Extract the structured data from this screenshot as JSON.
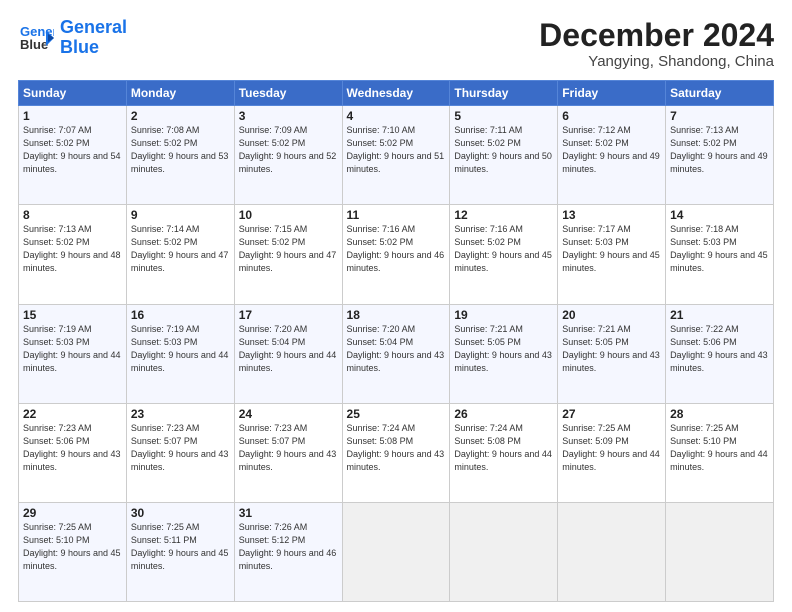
{
  "header": {
    "logo_line1": "General",
    "logo_line2": "Blue",
    "main_title": "December 2024",
    "subtitle": "Yangying, Shandong, China"
  },
  "days_of_week": [
    "Sunday",
    "Monday",
    "Tuesday",
    "Wednesday",
    "Thursday",
    "Friday",
    "Saturday"
  ],
  "weeks": [
    [
      {
        "num": "1",
        "sunrise": "7:07 AM",
        "sunset": "5:02 PM",
        "daylight": "9 hours and 54 minutes."
      },
      {
        "num": "2",
        "sunrise": "7:08 AM",
        "sunset": "5:02 PM",
        "daylight": "9 hours and 53 minutes."
      },
      {
        "num": "3",
        "sunrise": "7:09 AM",
        "sunset": "5:02 PM",
        "daylight": "9 hours and 52 minutes."
      },
      {
        "num": "4",
        "sunrise": "7:10 AM",
        "sunset": "5:02 PM",
        "daylight": "9 hours and 51 minutes."
      },
      {
        "num": "5",
        "sunrise": "7:11 AM",
        "sunset": "5:02 PM",
        "daylight": "9 hours and 50 minutes."
      },
      {
        "num": "6",
        "sunrise": "7:12 AM",
        "sunset": "5:02 PM",
        "daylight": "9 hours and 49 minutes."
      },
      {
        "num": "7",
        "sunrise": "7:13 AM",
        "sunset": "5:02 PM",
        "daylight": "9 hours and 49 minutes."
      }
    ],
    [
      {
        "num": "8",
        "sunrise": "7:13 AM",
        "sunset": "5:02 PM",
        "daylight": "9 hours and 48 minutes."
      },
      {
        "num": "9",
        "sunrise": "7:14 AM",
        "sunset": "5:02 PM",
        "daylight": "9 hours and 47 minutes."
      },
      {
        "num": "10",
        "sunrise": "7:15 AM",
        "sunset": "5:02 PM",
        "daylight": "9 hours and 47 minutes."
      },
      {
        "num": "11",
        "sunrise": "7:16 AM",
        "sunset": "5:02 PM",
        "daylight": "9 hours and 46 minutes."
      },
      {
        "num": "12",
        "sunrise": "7:16 AM",
        "sunset": "5:02 PM",
        "daylight": "9 hours and 45 minutes."
      },
      {
        "num": "13",
        "sunrise": "7:17 AM",
        "sunset": "5:03 PM",
        "daylight": "9 hours and 45 minutes."
      },
      {
        "num": "14",
        "sunrise": "7:18 AM",
        "sunset": "5:03 PM",
        "daylight": "9 hours and 45 minutes."
      }
    ],
    [
      {
        "num": "15",
        "sunrise": "7:19 AM",
        "sunset": "5:03 PM",
        "daylight": "9 hours and 44 minutes."
      },
      {
        "num": "16",
        "sunrise": "7:19 AM",
        "sunset": "5:03 PM",
        "daylight": "9 hours and 44 minutes."
      },
      {
        "num": "17",
        "sunrise": "7:20 AM",
        "sunset": "5:04 PM",
        "daylight": "9 hours and 44 minutes."
      },
      {
        "num": "18",
        "sunrise": "7:20 AM",
        "sunset": "5:04 PM",
        "daylight": "9 hours and 43 minutes."
      },
      {
        "num": "19",
        "sunrise": "7:21 AM",
        "sunset": "5:05 PM",
        "daylight": "9 hours and 43 minutes."
      },
      {
        "num": "20",
        "sunrise": "7:21 AM",
        "sunset": "5:05 PM",
        "daylight": "9 hours and 43 minutes."
      },
      {
        "num": "21",
        "sunrise": "7:22 AM",
        "sunset": "5:06 PM",
        "daylight": "9 hours and 43 minutes."
      }
    ],
    [
      {
        "num": "22",
        "sunrise": "7:23 AM",
        "sunset": "5:06 PM",
        "daylight": "9 hours and 43 minutes."
      },
      {
        "num": "23",
        "sunrise": "7:23 AM",
        "sunset": "5:07 PM",
        "daylight": "9 hours and 43 minutes."
      },
      {
        "num": "24",
        "sunrise": "7:23 AM",
        "sunset": "5:07 PM",
        "daylight": "9 hours and 43 minutes."
      },
      {
        "num": "25",
        "sunrise": "7:24 AM",
        "sunset": "5:08 PM",
        "daylight": "9 hours and 43 minutes."
      },
      {
        "num": "26",
        "sunrise": "7:24 AM",
        "sunset": "5:08 PM",
        "daylight": "9 hours and 44 minutes."
      },
      {
        "num": "27",
        "sunrise": "7:25 AM",
        "sunset": "5:09 PM",
        "daylight": "9 hours and 44 minutes."
      },
      {
        "num": "28",
        "sunrise": "7:25 AM",
        "sunset": "5:10 PM",
        "daylight": "9 hours and 44 minutes."
      }
    ],
    [
      {
        "num": "29",
        "sunrise": "7:25 AM",
        "sunset": "5:10 PM",
        "daylight": "9 hours and 45 minutes."
      },
      {
        "num": "30",
        "sunrise": "7:25 AM",
        "sunset": "5:11 PM",
        "daylight": "9 hours and 45 minutes."
      },
      {
        "num": "31",
        "sunrise": "7:26 AM",
        "sunset": "5:12 PM",
        "daylight": "9 hours and 46 minutes."
      },
      null,
      null,
      null,
      null
    ]
  ]
}
